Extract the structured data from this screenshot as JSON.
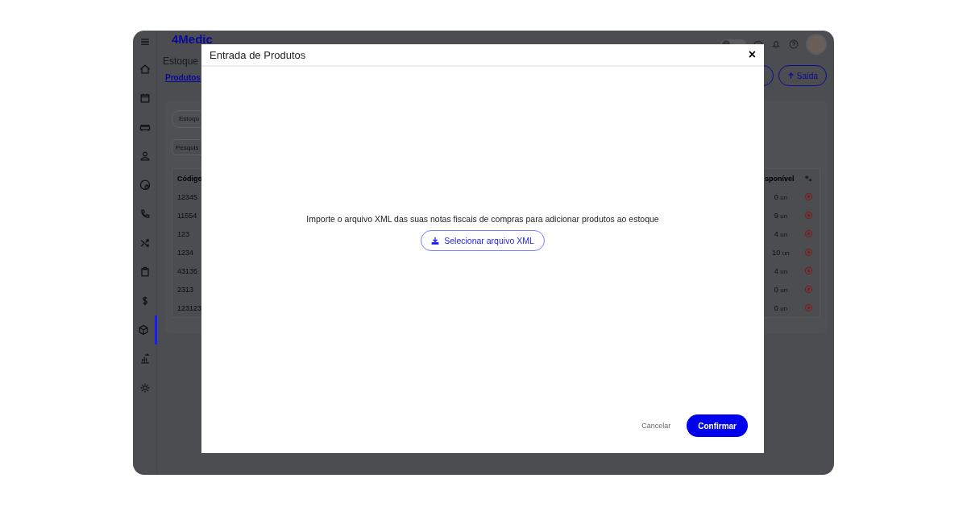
{
  "app": {
    "logo": "4Medic",
    "page_title": "Estoque",
    "tab": "Produtos",
    "dark_mode": {
      "on": false
    },
    "exit_button": "Saída",
    "filter": "Estoqu",
    "search_placeholder": "Pesquis",
    "sidebar": [
      {
        "kind": "home",
        "selected": false
      },
      {
        "kind": "calendar",
        "selected": false
      },
      {
        "kind": "sofa",
        "selected": false
      },
      {
        "kind": "user",
        "selected": false
      },
      {
        "kind": "at",
        "selected": false
      },
      {
        "kind": "phone",
        "selected": false
      },
      {
        "kind": "shuffle",
        "selected": false
      },
      {
        "kind": "clipboard",
        "selected": false
      },
      {
        "kind": "dollar",
        "selected": false
      },
      {
        "kind": "box",
        "selected": true
      },
      {
        "kind": "chart",
        "selected": false
      },
      {
        "kind": "gear",
        "selected": false
      }
    ],
    "table": {
      "columns": [
        "Código",
        "sponível"
      ],
      "rows": [
        {
          "code": "12345",
          "qty": "0",
          "unit": "un"
        },
        {
          "code": "11554",
          "qty": "9",
          "unit": "un"
        },
        {
          "code": "123",
          "qty": "4",
          "unit": "un"
        },
        {
          "code": "1234",
          "qty": "10",
          "unit": "un"
        },
        {
          "code": "43135",
          "qty": "4",
          "unit": "un"
        },
        {
          "code": "2313",
          "qty": "0",
          "unit": "un"
        },
        {
          "code": "123123",
          "qty": "0",
          "unit": "un"
        }
      ]
    }
  },
  "modal": {
    "title": "Entrada de Produtos",
    "close": "×",
    "message": "Importe o arquivo XML das suas notas fiscais de compras para adicionar produtos ao estoque",
    "select_button": "Selecionar arquivo XML",
    "cancel": "Cancelar",
    "confirm": "Confirmar"
  }
}
